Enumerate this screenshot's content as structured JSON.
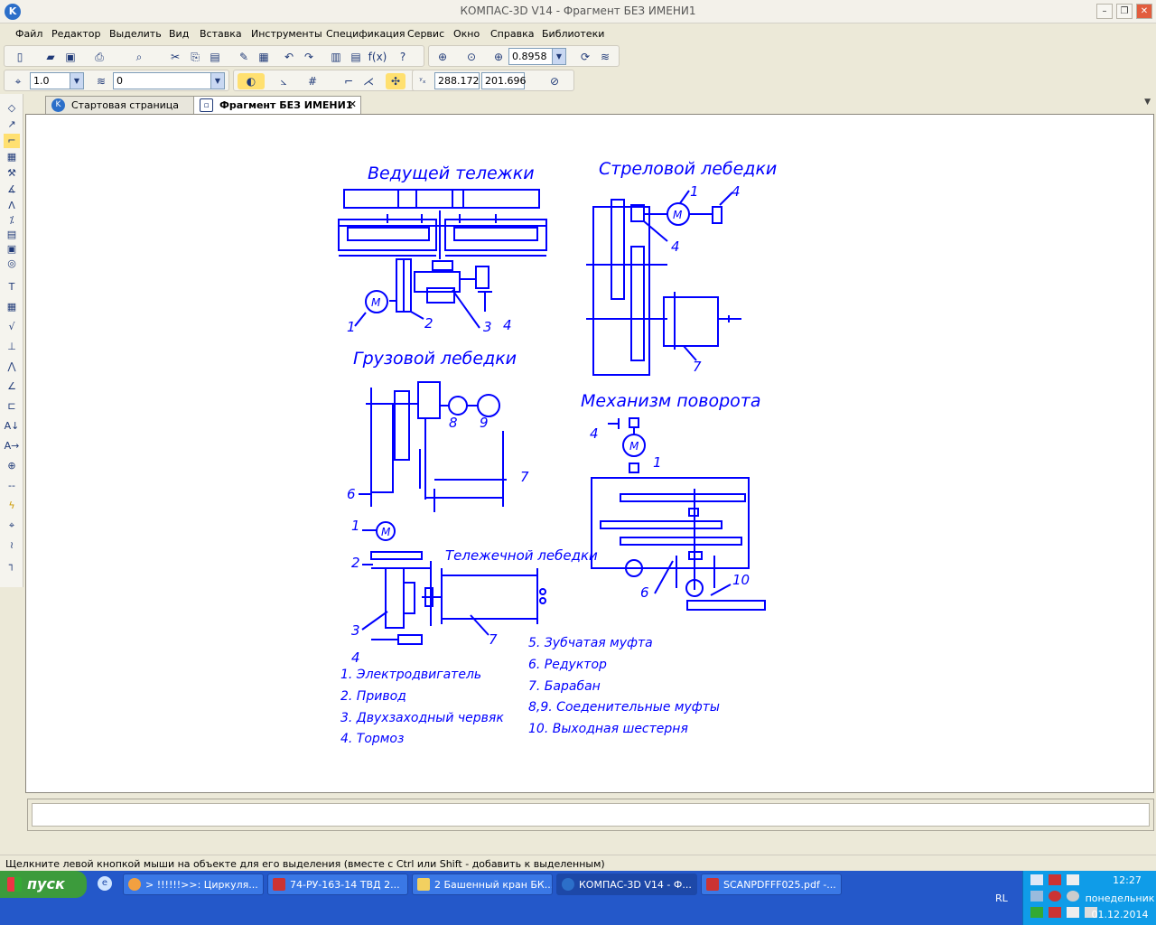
{
  "window": {
    "title": "КОМПАС-3D V14 - Фрагмент БЕЗ ИМЕНИ1",
    "app_icon": "K"
  },
  "menu": [
    "Файл",
    "Редактор",
    "Выделить",
    "Вид",
    "Вставка",
    "Инструменты",
    "Спецификация",
    "Сервис",
    "Окно",
    "Справка",
    "Библиотеки"
  ],
  "toolbar": {
    "zoom": "0.8958",
    "scale": "1.0",
    "layer": "0",
    "coord_x": "288.172",
    "coord_y": "201.696"
  },
  "tabs": [
    {
      "label": "Стартовая страница"
    },
    {
      "label": "Фрагмент БЕЗ ИМЕНИ1"
    }
  ],
  "drawing": {
    "titles": {
      "t1": "Ведущей тележки",
      "t2": "Стреловой лебедки",
      "t3": "Грузовой лебедки",
      "t4": "Механизм поворота",
      "t5": "Тележечной лебедки"
    },
    "legend_left": [
      "1. Электродвигатель",
      "2. Привод",
      "3. Двухзаходный червяк",
      "4. Тормоз"
    ],
    "legend_right": [
      "5. Зубчатая муфта",
      "6. Редуктор",
      "7. Барабан",
      "8,9. Соеденительные муфты",
      "10. Выходная шестерня"
    ],
    "motor_letter": "M",
    "numbers": {
      "n1": "1",
      "n2": "2",
      "n3": "3",
      "n4": "4",
      "n6": "6",
      "n7": "7",
      "n8": "8",
      "n9": "9",
      "n10": "10"
    }
  },
  "status": "Щелкните левой кнопкой мыши на объекте для его выделения (вместе с Ctrl или Shift - добавить к выделенным)",
  "taskbar": {
    "start": "пуск",
    "tasks": [
      "> !!!!!!>>: Циркуля...",
      "74-РУ-163-14 ТВД 2...",
      "2 Башенный кран БК...",
      "КОМПАС-3D V14 - Ф...",
      "SCANPDFFF025.pdf -..."
    ],
    "lang": "RL",
    "time": "12:27",
    "day": "понедельник",
    "date": "01.12.2014"
  },
  "colors": {
    "line": "#0000ff",
    "taskbar": "#2458c9",
    "tray": "#0f9ce8"
  }
}
